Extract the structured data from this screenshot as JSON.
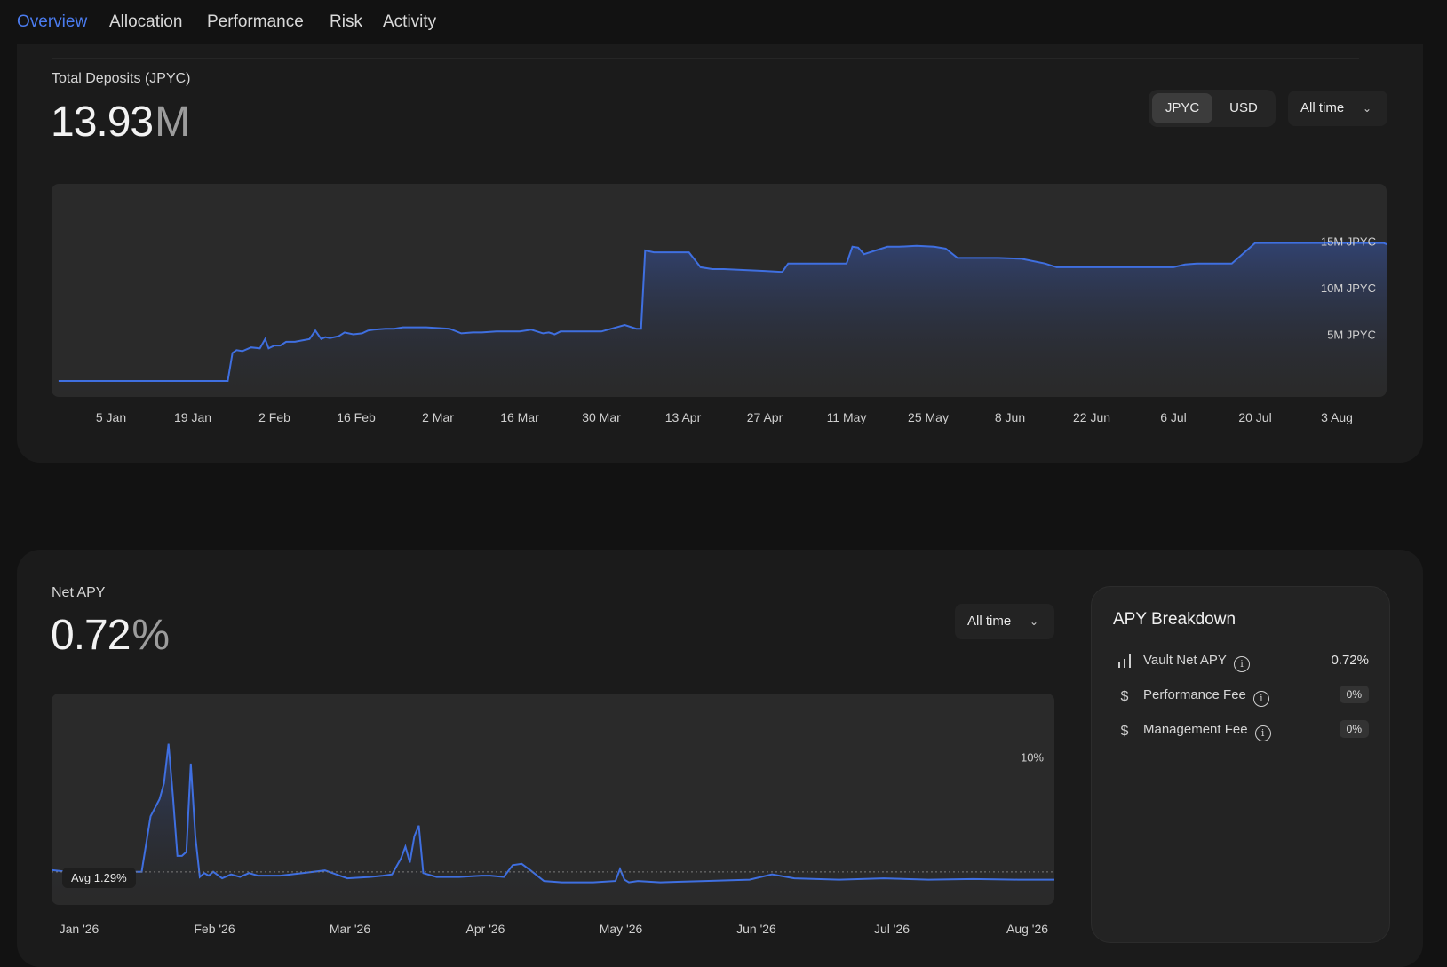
{
  "tabs": [
    {
      "label": "Overview",
      "active": true
    },
    {
      "label": "Allocation",
      "active": false
    },
    {
      "label": "Performance",
      "active": false
    },
    {
      "label": "Risk",
      "active": false
    },
    {
      "label": "Activity",
      "active": false
    }
  ],
  "deposits": {
    "label": "Total Deposits (JPYC)",
    "value": "13.93",
    "unit": "M",
    "toggle": [
      "JPYC",
      "USD"
    ],
    "toggle_selected": "JPYC",
    "range": "All time"
  },
  "apy": {
    "label": "Net APY",
    "value": "0.72",
    "unit": "%",
    "range": "All time",
    "avg_badge": "Avg 1.29%"
  },
  "breakdown": {
    "title": "APY Breakdown",
    "rows": [
      {
        "label": "Vault Net APY",
        "value": "0.72%",
        "icon": "bar-chart-icon"
      },
      {
        "label": "Performance Fee",
        "value": "0%",
        "icon": "dollar-icon"
      },
      {
        "label": "Management Fee",
        "value": "0%",
        "icon": "dollar-icon"
      }
    ]
  },
  "colors": {
    "accent": "#4b7cf0",
    "line": "#3f6fe0"
  },
  "chart_data": [
    {
      "type": "area",
      "title": "Total Deposits (JPYC)",
      "ylabel": "",
      "xlabel": "",
      "x_ticks": [
        "5 Jan",
        "19 Jan",
        "2 Feb",
        "16 Feb",
        "2 Mar",
        "16 Mar",
        "30 Mar",
        "13 Apr",
        "27 Apr",
        "11 May",
        "25 May",
        "8 Jun",
        "22 Jun",
        "6 Jul",
        "20 Jul",
        "3 Aug"
      ],
      "y_ticks": [
        {
          "value": 5,
          "label": "5M JPYC"
        },
        {
          "value": 10,
          "label": "10M JPYC"
        },
        {
          "value": 15,
          "label": "15M JPYC"
        }
      ],
      "ylim": [
        0,
        20
      ],
      "x_units": "days since 5 Jan",
      "series": [
        {
          "name": "",
          "x": [
            -9,
            10,
            20,
            20.8,
            21.5,
            22.5,
            24,
            25.5,
            26.4,
            27,
            28,
            29,
            30,
            31.5,
            34,
            35,
            36,
            36.7,
            37.5,
            39,
            40,
            41.5,
            43,
            44,
            45,
            47,
            48.5,
            50,
            54,
            58,
            60,
            62,
            63.5,
            66,
            70,
            72,
            74,
            75,
            76,
            77,
            78,
            84,
            88,
            90,
            90.8,
            91.5,
            93,
            99,
            101,
            103,
            105,
            112,
            115,
            116,
            117.5,
            123,
            126,
            127,
            128,
            129,
            133,
            135,
            138,
            141,
            143,
            145,
            146,
            152,
            156,
            160,
            162,
            163,
            167,
            168.5,
            174,
            178,
            182,
            184,
            186,
            192,
            196,
            200,
            201,
            205,
            215,
            218,
            222
          ],
          "y": [
            0,
            0,
            0,
            3.0,
            3.3,
            3.2,
            3.6,
            3.5,
            4.5,
            3.5,
            3.8,
            3.8,
            4.2,
            4.2,
            4.5,
            5.4,
            4.5,
            4.7,
            4.6,
            4.8,
            5.2,
            5.0,
            5.1,
            5.4,
            5.5,
            5.6,
            5.6,
            5.75,
            5.75,
            5.6,
            5.1,
            5.2,
            5.2,
            5.3,
            5.3,
            5.5,
            5.1,
            5.2,
            5.0,
            5.3,
            5.3,
            5.3,
            6.0,
            5.6,
            5.6,
            14.0,
            13.8,
            13.8,
            12.2,
            12.0,
            12.0,
            11.8,
            11.7,
            12.6,
            12.6,
            12.6,
            12.6,
            14.4,
            14.3,
            13.6,
            14.4,
            14.4,
            14.5,
            14.4,
            14.2,
            13.2,
            13.2,
            13.2,
            13.1,
            12.6,
            12.2,
            12.2,
            12.2,
            12.2,
            12.2,
            12.2,
            12.2,
            12.5,
            12.6,
            12.6,
            14.8,
            14.8,
            14.8,
            14.8,
            14.8,
            14.8,
            13.8
          ]
        }
      ]
    },
    {
      "type": "line",
      "title": "Net APY",
      "ylabel": "",
      "xlabel": "",
      "x_ticks": [
        "Jan '26",
        "Feb '26",
        "Mar '26",
        "Apr '26",
        "May '26",
        "Jun '26",
        "Jul '26",
        "Aug '26"
      ],
      "y_ticks": [
        {
          "value": 10,
          "label": "10%"
        }
      ],
      "ylim": [
        0,
        14
      ],
      "x_units": "days since 1 Jan 2026",
      "average": 1.29,
      "series": [
        {
          "name": "",
          "x": [
            -8,
            0,
            2,
            4,
            6,
            8,
            10,
            12,
            14,
            16,
            18,
            19,
            20,
            21,
            22,
            23,
            24,
            25,
            26,
            27,
            28,
            29,
            30,
            32,
            34,
            36,
            38,
            40,
            45,
            50,
            55,
            60,
            65,
            68,
            70,
            72,
            73,
            74,
            75,
            76,
            77,
            80,
            85,
            90,
            92,
            95,
            97,
            99,
            101,
            104,
            108,
            115,
            120,
            121,
            122,
            123,
            125,
            130,
            140,
            150,
            155,
            160,
            170,
            180,
            190,
            200,
            210,
            220
          ],
          "y": [
            1.5,
            1.2,
            1.0,
            1.4,
            1.0,
            1.2,
            1.0,
            1.3,
            1.3,
            5.5,
            6.8,
            8.0,
            11.0,
            7.0,
            2.5,
            2.5,
            2.8,
            9.5,
            4.0,
            0.9,
            1.2,
            1.0,
            1.3,
            0.8,
            1.1,
            0.9,
            1.2,
            1.0,
            1.0,
            1.2,
            1.4,
            0.8,
            0.9,
            1.0,
            1.1,
            2.3,
            3.2,
            2.0,
            4.0,
            4.8,
            1.2,
            0.9,
            0.9,
            1.0,
            1.0,
            0.9,
            1.8,
            1.9,
            1.4,
            0.6,
            0.5,
            0.5,
            0.6,
            1.5,
            0.7,
            0.5,
            0.6,
            0.5,
            0.6,
            0.7,
            1.1,
            0.8,
            0.7,
            0.8,
            0.7,
            0.75,
            0.7,
            0.7
          ]
        }
      ]
    }
  ]
}
